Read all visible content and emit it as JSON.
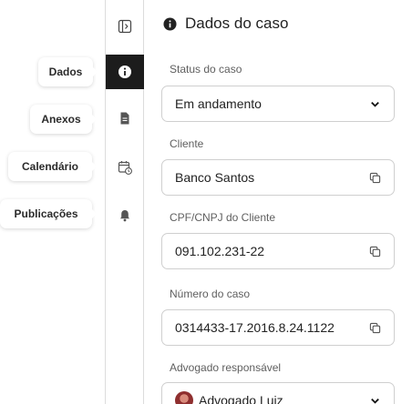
{
  "nav": {
    "dados": "Dados",
    "anexos": "Anexos",
    "calendario": "Calendário",
    "publicacoes": "Publicações"
  },
  "rail": {
    "icons": [
      "sidebar-toggle-icon",
      "info-icon",
      "document-icon",
      "calendar-clock-icon",
      "bell-icon"
    ],
    "active": "info-icon"
  },
  "panel": {
    "title": "Dados do caso",
    "status": {
      "label": "Status do caso",
      "value": "Em andamento"
    },
    "cliente": {
      "label": "Cliente",
      "value": "Banco Santos"
    },
    "cpf": {
      "label": "CPF/CNPJ do Cliente",
      "value": "091.102.231-22"
    },
    "numero": {
      "label": "Número do caso",
      "value": "0314433-17.2016.8.24.1122"
    },
    "advogado": {
      "label": "Advogado responsável",
      "value": "Advogado Luiz"
    }
  },
  "colors": {
    "active_rail": "#1c1c1c",
    "border": "#cfcfcf",
    "label": "#5f5f5f"
  }
}
